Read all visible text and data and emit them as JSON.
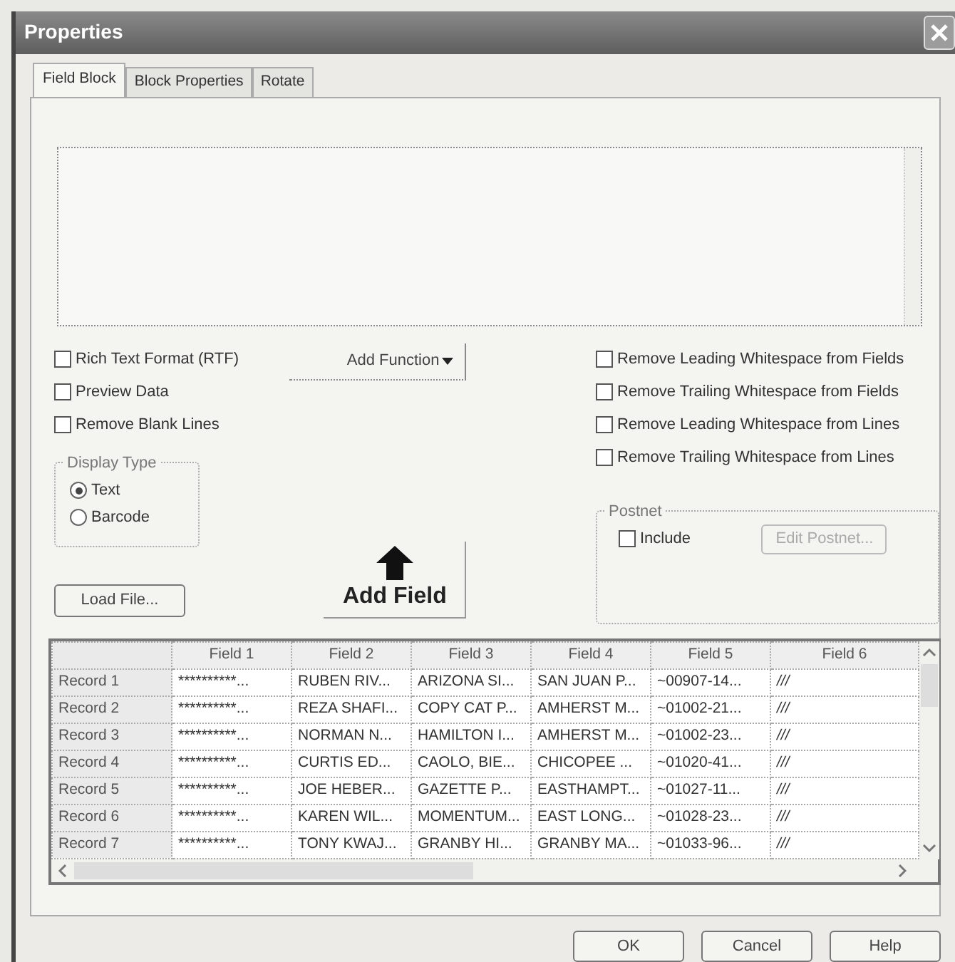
{
  "window": {
    "title": "Properties"
  },
  "tabs": [
    {
      "label": "Field Block",
      "selected": true
    },
    {
      "label": "Block Properties",
      "selected": false
    },
    {
      "label": "Rotate",
      "selected": false
    }
  ],
  "options_left": [
    {
      "label": "Rich Text Format (RTF)",
      "checked": false
    },
    {
      "label": "Preview Data",
      "checked": false
    },
    {
      "label": "Remove Blank Lines",
      "checked": false
    }
  ],
  "add_function_button": {
    "label": "Add Function"
  },
  "options_right": [
    {
      "label": "Remove Leading Whitespace from Fields",
      "checked": false
    },
    {
      "label": "Remove Trailing Whitespace from Fields",
      "checked": false
    },
    {
      "label": "Remove Leading Whitespace from Lines",
      "checked": false
    },
    {
      "label": "Remove Trailing Whitespace from Lines",
      "checked": false
    }
  ],
  "display_type": {
    "label": "Display Type",
    "options": [
      {
        "label": "Text",
        "selected": true
      },
      {
        "label": "Barcode",
        "selected": false
      }
    ]
  },
  "postnet": {
    "label": "Postnet",
    "include": {
      "label": "Include",
      "checked": false
    },
    "edit_button": {
      "label": "Edit Postnet...",
      "disabled": true
    }
  },
  "load_file_button": {
    "label": "Load File..."
  },
  "add_field_button": {
    "label": "Add Field"
  },
  "grid": {
    "columns": [
      "Field 1",
      "Field 2",
      "Field 3",
      "Field 4",
      "Field 5",
      "Field 6"
    ],
    "rows": [
      {
        "header": "Record 1",
        "cells": [
          "**********...",
          "RUBEN RIV...",
          "ARIZONA SI...",
          "SAN JUAN P...",
          "~00907-14...",
          "///"
        ]
      },
      {
        "header": "Record 2",
        "cells": [
          "**********...",
          "REZA SHAFI...",
          "COPY CAT P...",
          "AMHERST M...",
          "~01002-21...",
          "///"
        ]
      },
      {
        "header": "Record 3",
        "cells": [
          "**********...",
          "NORMAN N...",
          "HAMILTON I...",
          "AMHERST M...",
          "~01002-23...",
          "///"
        ]
      },
      {
        "header": "Record 4",
        "cells": [
          "**********...",
          "CURTIS ED...",
          "CAOLO, BIE...",
          "CHICOPEE ...",
          "~01020-41...",
          "///"
        ]
      },
      {
        "header": "Record 5",
        "cells": [
          "**********...",
          "JOE HEBER...",
          "GAZETTE P...",
          "EASTHAMPT...",
          "~01027-11...",
          "///"
        ]
      },
      {
        "header": "Record 6",
        "cells": [
          "**********...",
          "KAREN WIL...",
          "MOMENTUM...",
          "EAST LONG...",
          "~01028-23...",
          "///"
        ]
      },
      {
        "header": "Record 7",
        "cells": [
          "**********...",
          "TONY KWAJ...",
          "GRANBY HI...",
          "GRANBY MA...",
          "~01033-96...",
          "///"
        ]
      }
    ]
  },
  "buttons": [
    {
      "label": "OK"
    },
    {
      "label": "Cancel"
    },
    {
      "label": "Help"
    }
  ]
}
